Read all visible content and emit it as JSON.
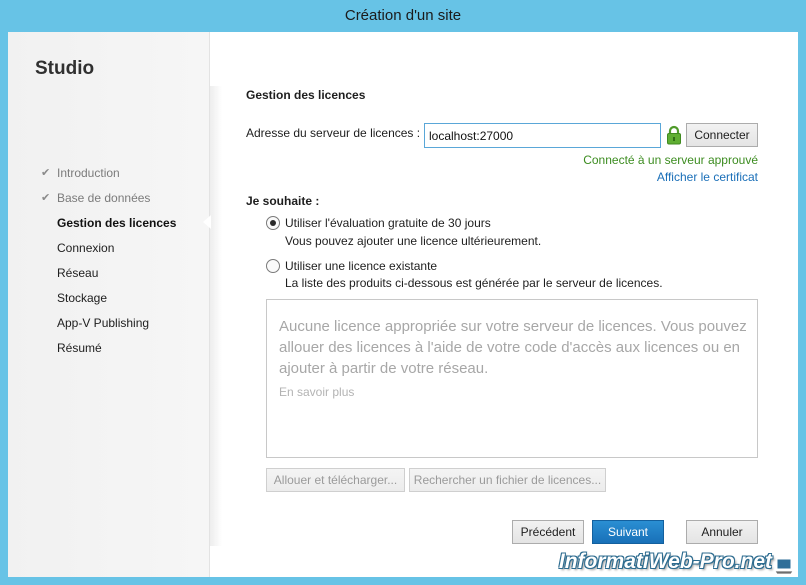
{
  "window": {
    "title": "Création d'un site"
  },
  "sidebar": {
    "brand": "Studio",
    "steps": [
      {
        "label": "Introduction",
        "state": "done"
      },
      {
        "label": "Base de données",
        "state": "done"
      },
      {
        "label": "Gestion des licences",
        "state": "current"
      },
      {
        "label": "Connexion",
        "state": "pending"
      },
      {
        "label": "Réseau",
        "state": "pending"
      },
      {
        "label": "Stockage",
        "state": "pending"
      },
      {
        "label": "App-V Publishing",
        "state": "pending"
      },
      {
        "label": "Résumé",
        "state": "pending"
      }
    ]
  },
  "main": {
    "title": "Gestion des licences",
    "server": {
      "label": "Adresse du serveur de licences :",
      "value": "localhost:27000",
      "connect_label": "Connecter",
      "status": "Connecté à un serveur approuvé",
      "cert_link": "Afficher le certificat",
      "status_color": "#3c8c20"
    },
    "wish_label": "Je souhaite :",
    "options": [
      {
        "label": "Utiliser l'évaluation gratuite de 30 jours",
        "desc": "Vous pouvez ajouter une licence ultérieurement.",
        "checked": true
      },
      {
        "label": "Utiliser une licence existante",
        "desc": "La liste des produits ci-dessous est générée par le serveur de licences.",
        "checked": false
      }
    ],
    "license_box": {
      "message": "Aucune licence appropriée sur votre serveur de licences. Vous pouvez allouer des licences à l'aide de votre code d'accès aux licences ou en ajouter à partir de votre réseau.",
      "learn_more": "En savoir plus"
    },
    "allocate_label": "Allouer et télécharger...",
    "search_label": "Rechercher un fichier de licences..."
  },
  "footer": {
    "prev_label": "Précédent",
    "next_label": "Suivant",
    "cancel_label": "Annuler"
  },
  "watermark": "InformatiWeb-Pro.net",
  "colors": {
    "titlebar": "#67c3e6",
    "accent": "#1870b8",
    "link": "#1a6fb8"
  },
  "icons": {
    "check": "check-icon",
    "lock": "lock-icon"
  }
}
